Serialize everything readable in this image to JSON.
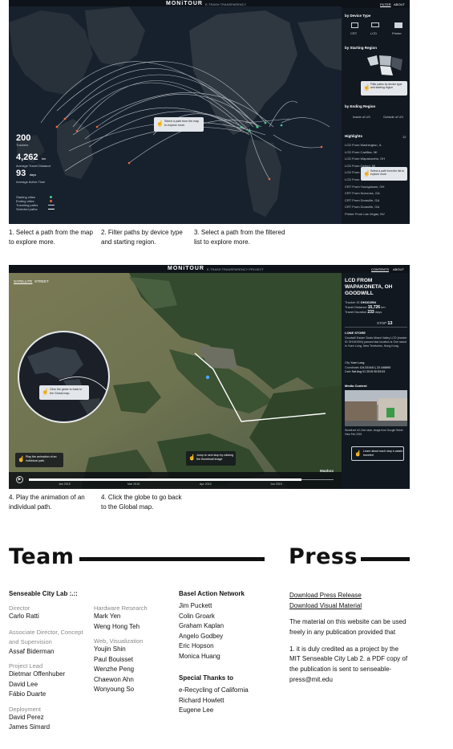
{
  "shot1": {
    "brand": "MONiTOUR",
    "brand_sub": "E-TRASH TRANSPARENCY",
    "nav": [
      "FILTER",
      "ABOUT"
    ],
    "filters": {
      "device_type_title": "by Device Type",
      "devices": [
        "CRT",
        "LCD",
        "Printer"
      ],
      "starting_region_title": "by Starting Region",
      "filter_tip": "Filter paths by device type and starting region",
      "ending_region_title": "by Ending Region",
      "ending_regions": [
        "Inside of US",
        "Outside of US"
      ],
      "highlights_title": "Highlights",
      "highlights_count": "12",
      "highlights": [
        "LCD From Washington, IL",
        "LCD From Cadillac, MI",
        "LCD From Wapakoneta, OH",
        "LCD From Oxford, MI",
        "LCD From ...",
        "LCD From ...",
        "CRT From Youngstown, OH",
        "CRT From Norcross, GA",
        "CRT From Doraville, GA",
        "CRT From Doraville, GA",
        "Printer From Las Vegas, NV"
      ],
      "select_tip": "Select a path from the list to explore more."
    },
    "map_tip": "Select a path from the map to explore more.",
    "stats": [
      {
        "value": "200",
        "label": "Trackers"
      },
      {
        "value": "4,262",
        "unit": "km",
        "label": "Average Travel Distance"
      },
      {
        "value": "93",
        "unit": "days",
        "label": "Average Active Time"
      }
    ],
    "legend": [
      {
        "label": "Starting cities",
        "color": "#3fd38b"
      },
      {
        "label": "Ending cities",
        "color": "#f0663a"
      },
      {
        "label": "Traveling paths",
        "color": "#c9cfd6"
      },
      {
        "label": "Selected paths",
        "color": "#ffffff"
      }
    ]
  },
  "captions1": [
    "1. Select a path from the map to explore more.",
    "2. Filter paths by device type and starting region.",
    "3. Select a path from the filtered list to explore more."
  ],
  "shot2": {
    "brand": "MONiTOUR",
    "brand_sub": "E-TRASH TRANSPARENCY PROJECT",
    "nav": [
      "CONTENTS",
      "ABOUT"
    ],
    "map_modes": [
      "SATELLITE",
      "STREET"
    ],
    "title": "LCD FROM WAPAKONETA, OH GOODWILL",
    "tracker_id_label": "Tracker ID",
    "tracker_id": "OH161594",
    "travel_distance_label": "Travel Distance",
    "travel_distance": "15,726",
    "travel_distance_unit": "km",
    "travel_duration_label": "Travel Duration",
    "travel_duration": "233",
    "travel_duration_unit": "days",
    "stop_label": "STOP",
    "stop_number": "13",
    "store_title": "I-ONE STORE",
    "store_desc": "Goodwill Easter Seals Miami Valley LCD (tracker ID OH161594) passed last location is One stand in Yuen Long, New Territories, Hong Kong.",
    "city_label": "City",
    "city": "Yuen Long",
    "coord_label": "Coordinate",
    "coordinate": "114.021441 | 22.446890",
    "date_label": "Date",
    "date": "Sat Aug 01 2015 00:53:03",
    "media_title": "Media Content",
    "photo_caption": "Storefront of i-One store, image from Google Street View Feb 2015",
    "globe_tip": "Click the globe to back to the Global map.",
    "play_tip": "Play the animation of an individual path.",
    "jump_tip": "Jump to next stop by clicking the thumbnail image",
    "learn_tip": "Learn about each stop e-waste traveled",
    "logo": "Mapbox",
    "timeline_labels": [
      "Jan 2015",
      "Mar 2015",
      "Apr 2015",
      "Jun 2015"
    ]
  },
  "captions2": [
    "4. Play the animation of an individual path.",
    "4. Click the globe to go back to the Global map."
  ],
  "team": {
    "heading": "Team",
    "lab": "Senseable City Lab :.::",
    "groups_col1": [
      {
        "role": "Director",
        "names": [
          "Carlo Ratti"
        ]
      },
      {
        "role": "Associate Director, Concept and Supervision",
        "names": [
          "Assaf Biderman"
        ]
      },
      {
        "role": "Project Lead",
        "names": [
          "Dietmar Offenhuber",
          "David Lee",
          "Fábio Duarte"
        ]
      },
      {
        "role": "Deployment",
        "names": [
          "David Perez",
          "James Simard"
        ]
      }
    ],
    "groups_col2": [
      {
        "role": "Hardware Research",
        "names": [
          "Mark Yen",
          "Weng Hong Teh"
        ]
      },
      {
        "role": "Web, Visualization",
        "names": [
          "Youjin Shin",
          "Paul Bouisset",
          "Wenzhe Peng",
          "Chaewon Ahn",
          "Wonyoung So"
        ]
      }
    ],
    "ban_title": "Basel Action Network",
    "ban_names": [
      "Jim Puckett",
      "Colin Groark",
      "Graham Kaplan",
      "Angelo Godbey",
      "Eric Hopson",
      "Monica Huang"
    ],
    "thanks_title": "Special Thanks to",
    "thanks_names": [
      "e-Recycling of California",
      "Richard Howlett",
      "Eugene Lee"
    ]
  },
  "press": {
    "heading": "Press",
    "links": [
      "Download Press Release",
      "Download Visual Material"
    ],
    "text1": "The material on this website can be used freely in any publication provided that",
    "text2": "1. it is duly credited as a project by the MIT Senseable City Lab 2. a PDF copy of the publication is sent to senseable-press@mit.edu"
  }
}
